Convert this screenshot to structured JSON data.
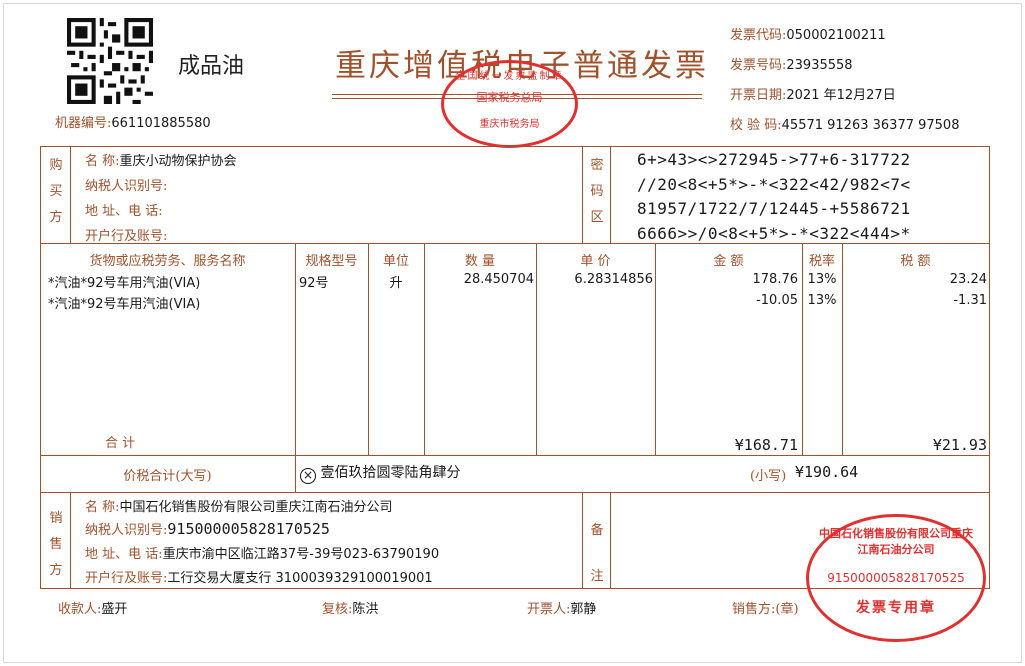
{
  "header": {
    "product_type": "成品油",
    "title": "重庆增值税电子普通发票",
    "machine_no_label": "机器编号:",
    "machine_no": "661101885580",
    "invoice_code_label": "发票代码:",
    "invoice_code": "050002100211",
    "invoice_no_label": "发票号码:",
    "invoice_no": "23935558",
    "issue_date_label": "开票日期:",
    "issue_date": "2021 年12月27日",
    "check_code_label": "校 验 码:",
    "check_code": "45571 91263 36377 97508"
  },
  "buyer": {
    "side_label": [
      "购",
      "买",
      "方"
    ],
    "name_label": "名          称:",
    "name": "重庆小动物保护协会",
    "taxid_label": "纳税人识别号:",
    "taxid": "",
    "address_label": "地 址、电 话:",
    "address": "",
    "bank_label": "开户行及账号:",
    "bank": ""
  },
  "cipher": {
    "side_label": [
      "密",
      "码",
      "区"
    ],
    "lines": [
      "6+>43><>272945->77+6-317722",
      "//20<8<+5*>-*<322<42/982<7<",
      "81957/1722/7/12445-+5586721",
      "6666>>/0<8<+5*>-*<322<444>*"
    ]
  },
  "items_header": {
    "name": "货物或应税劳务、服务名称",
    "spec": "规格型号",
    "unit": "单位",
    "qty": "数  量",
    "price": "单  价",
    "amount": "金  额",
    "rate": "税率",
    "tax": "税  额"
  },
  "items": [
    {
      "name": "*汽油*92号车用汽油(VIA)",
      "spec": "92号",
      "unit": "升",
      "qty": "28.450704",
      "price": "6.28314856",
      "amount": "178.76",
      "rate": "13%",
      "tax": "23.24"
    },
    {
      "name": "*汽油*92号车用汽油(VIA)",
      "spec": "",
      "unit": "",
      "qty": "",
      "price": "",
      "amount": "-10.05",
      "rate": "13%",
      "tax": "-1.31"
    }
  ],
  "totals": {
    "label": "合      计",
    "amount": "¥168.71",
    "tax": "¥21.93",
    "grand_label": "价税合计(大写)",
    "grand_words": "壹佰玖拾圆零陆角肆分",
    "small_label": "(小写)",
    "grand_amount": "¥190.64"
  },
  "seller": {
    "side_label": [
      "销",
      "售",
      "方"
    ],
    "name_label": "名          称:",
    "name": "中国石化销售股份有限公司重庆江南石油分公司",
    "taxid_label": "纳税人识别号:",
    "taxid": "915000005828170525",
    "address_label": "地 址、电 话:",
    "address": "重庆市渝中区临江路37号-39号023-63790190",
    "bank_label": "开户行及账号:",
    "bank": "工行交易大厦支行 3100039329100019001"
  },
  "remarks": {
    "side_label": [
      "备",
      "注"
    ]
  },
  "footer": {
    "payee_label": "收款人:",
    "payee": "盛开",
    "reviewer_label": "复核:",
    "reviewer": "陈洪",
    "drawer_label": "开票人:",
    "drawer": "郭静",
    "seller_label": "销售方:(章)"
  },
  "stamps": {
    "tax_bureau_top": "全国统一发票监制章",
    "tax_bureau_mid": "国家税务总局",
    "tax_bureau_bottom": "重庆市税务局",
    "seller_ring": "中国石化销售股份有限公司重庆江南石油分公司",
    "seller_taxid": "915000005828170525",
    "seller_type": "发票专用章"
  },
  "colors": {
    "frame": "#a0522d",
    "stamp": "#e03030"
  }
}
